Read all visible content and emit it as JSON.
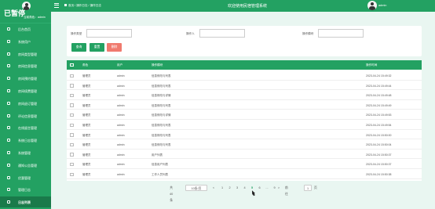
{
  "sidebar": {
    "brand": "已暂停",
    "role_label": "当前角色：admin",
    "items": [
      {
        "label": "后台首页"
      },
      {
        "label": "系统用户"
      },
      {
        "label": "房间类型管理"
      },
      {
        "label": "房间信息管理"
      },
      {
        "label": "房间预约管理"
      },
      {
        "label": "房间续费管理"
      },
      {
        "label": "房间退订管理"
      },
      {
        "label": "评论信息管理"
      },
      {
        "label": "在线留言管理"
      },
      {
        "label": "系统日志管理"
      },
      {
        "label": "系统管理"
      },
      {
        "label": "通知公告管理"
      },
      {
        "label": "优惠管理"
      },
      {
        "label": "管理日志"
      },
      {
        "label": "日志列表"
      }
    ],
    "active_index": 14
  },
  "topbar": {
    "breadcrumb": [
      "首页",
      "操作日志",
      "操作日志"
    ],
    "title": "欢迎使用民宿管理系统",
    "username": "admin"
  },
  "search": {
    "fields": [
      {
        "label": "操作类型",
        "value": "",
        "placeholder": ""
      },
      {
        "label": "操作人",
        "value": "",
        "placeholder": ""
      },
      {
        "label": "操作模块",
        "value": "",
        "placeholder": ""
      }
    ],
    "buttons": {
      "search": "查询",
      "reset": "重置",
      "delete": "删除"
    }
  },
  "table": {
    "columns": [
      "角色",
      "用户",
      "操作模块",
      "操作时间"
    ],
    "rows": [
      [
        "管理员",
        "admin",
        "信息修改与列表",
        "2023-04-24 15:49:32"
      ],
      [
        "管理员",
        "admin",
        "信息修改与列表",
        "2023-04-24 15:49:44"
      ],
      [
        "管理员",
        "admin",
        "信息修改与详情",
        "2023-04-24 15:49:48"
      ],
      [
        "管理员",
        "admin",
        "信息修改与列表",
        "2023-04-24 15:49:49"
      ],
      [
        "管理员",
        "admin",
        "信息修改与详情",
        "2023-04-24 15:49:53"
      ],
      [
        "管理员",
        "admin",
        "信息修改与列表",
        "2023-04-24 15:49:54"
      ],
      [
        "管理员",
        "admin",
        "信息修改与列表",
        "2023-04-24 15:50:00"
      ],
      [
        "管理员",
        "admin",
        "信息修改与列表",
        "2023-04-24 15:50:04"
      ],
      [
        "管理员",
        "admin",
        "用户列表",
        "2023-04-24 15:50:37"
      ],
      [
        "管理员",
        "admin",
        "信息用户列表",
        "2023-04-24 15:50:37"
      ],
      [
        "管理员",
        "admin",
        "工作人员列表",
        "2023-04-24 15:50:38"
      ]
    ]
  },
  "pager": {
    "total_label": "共 40 条",
    "page_size": "10条/页",
    "prev": "<",
    "next": ">",
    "pages": [
      "1",
      "2",
      "3",
      "4",
      "5",
      "6",
      "...",
      "9"
    ],
    "active_page": "5",
    "goto_label": "前往",
    "goto_value": "1",
    "page_suffix": "页"
  }
}
